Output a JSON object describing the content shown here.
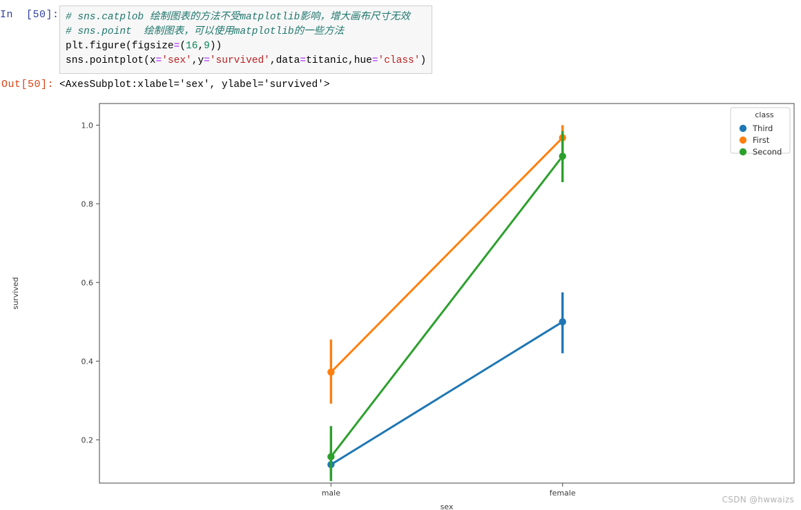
{
  "notebook": {
    "in_prompt": "In  [50]:",
    "out_prompt": "Out[50]:",
    "code_lines": [
      {
        "segments": [
          {
            "text": "# sns.catplob 绘制图表的方法不受matplotlib影响，增大画布尺寸无效",
            "type": "comment"
          }
        ]
      },
      {
        "segments": [
          {
            "text": "# sns.point  绘制图表，可以使用matplotlib的一些方法",
            "type": "comment"
          }
        ]
      },
      {
        "segments": [
          {
            "text": "plt.figure(figsize",
            "type": "plain"
          },
          {
            "text": "=",
            "type": "op"
          },
          {
            "text": "(",
            "type": "plain"
          },
          {
            "text": "16",
            "type": "number"
          },
          {
            "text": ",",
            "type": "plain"
          },
          {
            "text": "9",
            "type": "number"
          },
          {
            "text": "))",
            "type": "plain"
          }
        ]
      },
      {
        "segments": [
          {
            "text": "sns.pointplot(x",
            "type": "plain"
          },
          {
            "text": "=",
            "type": "op"
          },
          {
            "text": "'sex'",
            "type": "string"
          },
          {
            "text": ",y",
            "type": "plain"
          },
          {
            "text": "=",
            "type": "op"
          },
          {
            "text": "'survived'",
            "type": "string"
          },
          {
            "text": ",data",
            "type": "plain"
          },
          {
            "text": "=",
            "type": "op"
          },
          {
            "text": "titanic,hue",
            "type": "plain"
          },
          {
            "text": "=",
            "type": "op"
          },
          {
            "text": "'class'",
            "type": "string"
          },
          {
            "text": ")",
            "type": "plain"
          }
        ]
      }
    ],
    "output_text": "<AxesSubplot:xlabel='sex', ylabel='survived'>"
  },
  "watermark": "CSDN @hwwaizs",
  "chart_data": {
    "type": "line",
    "title": "",
    "xlabel": "sex",
    "ylabel": "survived",
    "categories": [
      "male",
      "female"
    ],
    "xlim": [
      -0.5,
      1.5
    ],
    "ylim": [
      0.09,
      1.055
    ],
    "yticks": [
      0.2,
      0.4,
      0.6,
      0.8,
      1.0
    ],
    "ytick_labels": [
      "0.2",
      "0.4",
      "0.6",
      "0.8",
      "1.0"
    ],
    "grid": false,
    "legend": {
      "title": "class",
      "position": "upper right",
      "entries": [
        "Third",
        "First",
        "Second"
      ]
    },
    "series": [
      {
        "name": "Third",
        "color": "#1f77b4",
        "values": [
          0.137,
          0.5
        ],
        "ci_low": [
          0.105,
          0.42
        ],
        "ci_high": [
          0.172,
          0.575
        ]
      },
      {
        "name": "First",
        "color": "#ff7f0e",
        "values": [
          0.372,
          0.968
        ],
        "ci_low": [
          0.292,
          0.93
        ],
        "ci_high": [
          0.455,
          1.0
        ]
      },
      {
        "name": "Second",
        "color": "#2ca02c",
        "values": [
          0.157,
          0.921
        ],
        "ci_low": [
          0.095,
          0.855
        ],
        "ci_high": [
          0.235,
          0.985
        ]
      }
    ]
  }
}
